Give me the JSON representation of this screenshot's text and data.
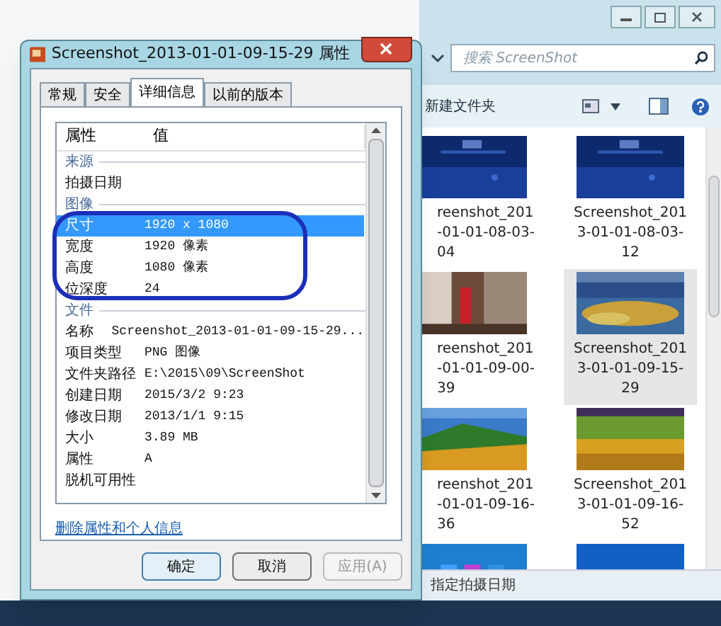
{
  "explorer": {
    "search": {
      "placeholder": "搜索 ScreenShot"
    },
    "toolbar": {
      "new_folder": "新建文件夹"
    },
    "items": [
      {
        "kind": "picture",
        "label": [
          "reenshot_201",
          "-01-01-08-03-",
          "04"
        ],
        "selected": false
      },
      {
        "kind": "picture",
        "label": [
          "Screenshot_201",
          "3-01-01-08-03-",
          "12"
        ],
        "selected": false
      },
      {
        "kind": "picture",
        "label": [
          "reenshot_201",
          "-01-01-09-00-",
          "39"
        ],
        "selected": false
      },
      {
        "kind": "picture",
        "label": [
          "Screenshot_201",
          "3-01-01-09-15-",
          "29"
        ],
        "selected": true
      },
      {
        "kind": "picture",
        "label": [
          "reenshot_201",
          "-01-01-09-16-",
          "36"
        ],
        "selected": false
      },
      {
        "kind": "picture",
        "label": [
          "Screenshot_201",
          "3-01-01-09-16-",
          "52"
        ],
        "selected": false
      },
      {
        "kind": "picture",
        "selected": false
      },
      {
        "kind": "picture",
        "selected": false
      }
    ],
    "status_bar": "指定拍摄日期"
  },
  "dialog": {
    "title": "Screenshot_2013-01-01-09-15-29 属性",
    "tabs": [
      {
        "label": "常规",
        "selected": false
      },
      {
        "label": "安全",
        "selected": false
      },
      {
        "label": "详细信息",
        "selected": true
      },
      {
        "label": "以前的版本",
        "selected": false
      }
    ],
    "columns": [
      "属性",
      "值"
    ],
    "rows": [
      {
        "kind": "group",
        "name": "来源"
      },
      {
        "kind": "row",
        "name": "拍摄日期",
        "selected": false
      },
      {
        "kind": "group",
        "name": "图像"
      },
      {
        "kind": "row",
        "name": "尺寸",
        "value": "1920 x 1080",
        "selected": true
      },
      {
        "kind": "row",
        "name": "宽度",
        "value": "1920 像素",
        "selected": false
      },
      {
        "kind": "row",
        "name": "高度",
        "value": "1080 像素",
        "selected": false
      },
      {
        "kind": "row",
        "name": "位深度",
        "value": "24",
        "selected": false
      },
      {
        "kind": "group",
        "name": "文件"
      },
      {
        "kind": "row",
        "name": "名称",
        "value": "Screenshot_2013-01-01-09-15-29...",
        "selected": false
      },
      {
        "kind": "row",
        "name": "项目类型",
        "value": "PNG 图像",
        "selected": false
      },
      {
        "kind": "row",
        "name": "文件夹路径",
        "value": "E:\\2015\\09\\ScreenShot",
        "selected": false
      },
      {
        "kind": "row",
        "name": "创建日期",
        "value": "2015/3/2 9:23",
        "selected": false
      },
      {
        "kind": "row",
        "name": "修改日期",
        "value": "2013/1/1 9:15",
        "selected": false
      },
      {
        "kind": "row",
        "name": "大小",
        "value": "3.89 MB",
        "selected": false
      },
      {
        "kind": "row",
        "name": "属性",
        "value": "A",
        "selected": false
      },
      {
        "kind": "row",
        "name": "脱机可用性",
        "selected": false
      }
    ],
    "link": "删除属性和个人信息",
    "buttons": [
      {
        "label": "确定",
        "disabled": false
      },
      {
        "label": "取消",
        "disabled": false
      },
      {
        "label": "应用(A)",
        "disabled": true
      }
    ]
  }
}
